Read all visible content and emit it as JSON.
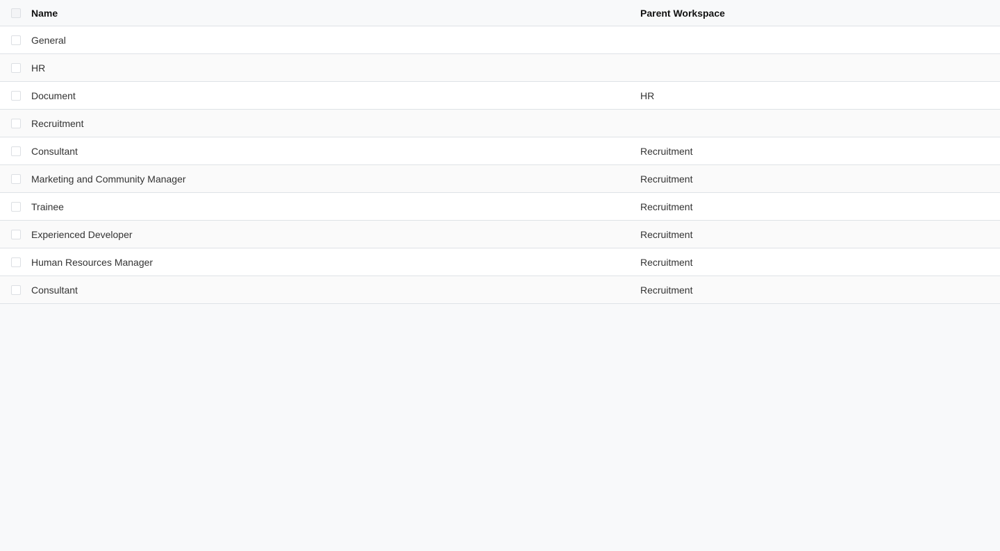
{
  "table": {
    "columns": {
      "name": "Name",
      "parent": "Parent Workspace"
    },
    "rows": [
      {
        "name": "General",
        "parent": ""
      },
      {
        "name": "HR",
        "parent": ""
      },
      {
        "name": "Document",
        "parent": "HR"
      },
      {
        "name": "Recruitment",
        "parent": ""
      },
      {
        "name": "Consultant",
        "parent": "Recruitment"
      },
      {
        "name": "Marketing and Community Manager",
        "parent": "Recruitment"
      },
      {
        "name": "Trainee",
        "parent": "Recruitment"
      },
      {
        "name": "Experienced Developer",
        "parent": "Recruitment"
      },
      {
        "name": "Human Resources Manager",
        "parent": "Recruitment"
      },
      {
        "name": "Consultant",
        "parent": "Recruitment"
      }
    ]
  },
  "colors": {
    "background": "#f8f9fa",
    "row_border": "#dee2e6",
    "checkbox_border": "#dcdfe3"
  }
}
